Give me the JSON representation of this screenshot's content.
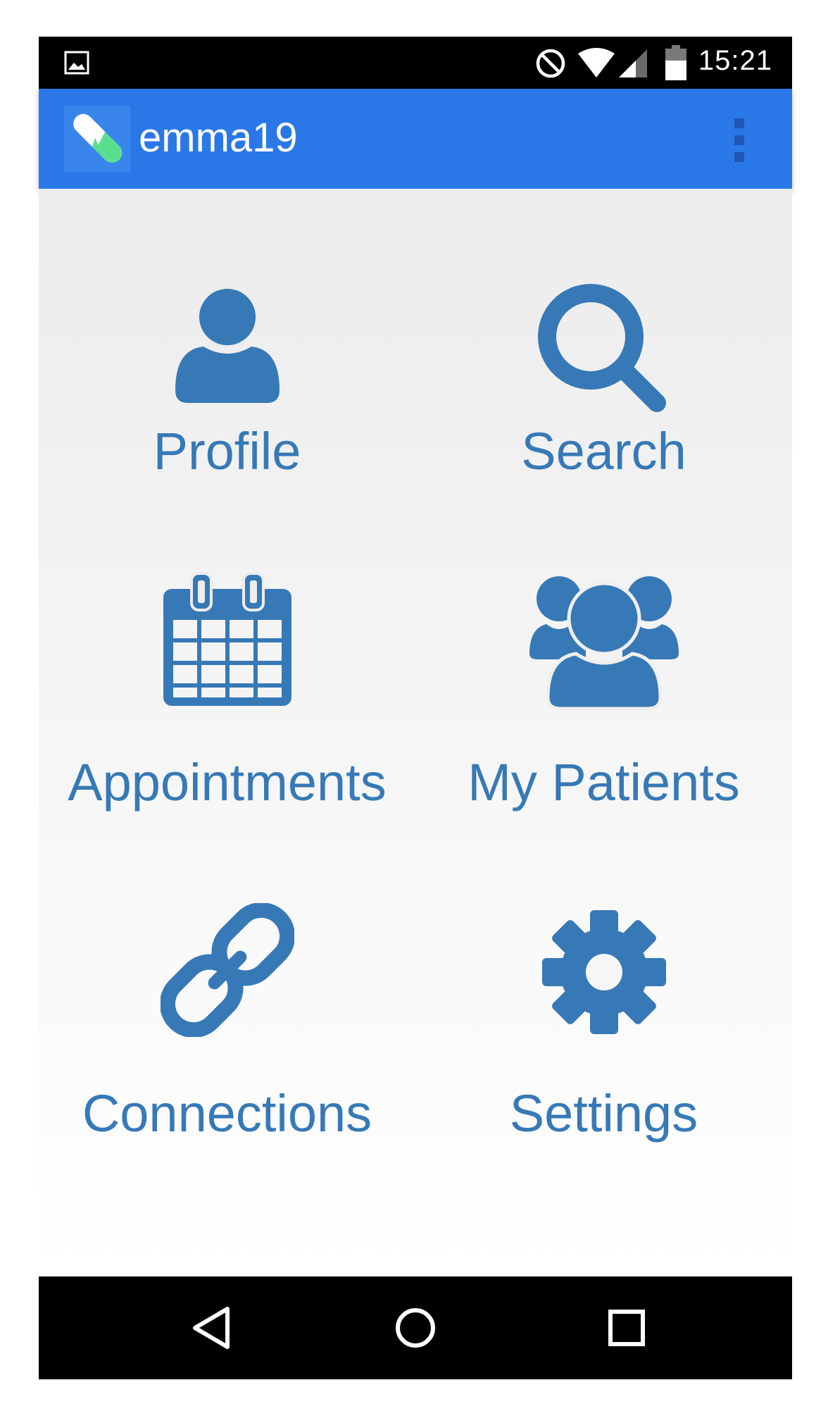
{
  "status_bar": {
    "time": "15:21",
    "icons": [
      "image-notification-icon",
      "do-not-disturb-icon",
      "wifi-icon",
      "cell-signal-icon",
      "battery-icon"
    ]
  },
  "app_bar": {
    "title": "emma19",
    "logo_icon": "pill-logo-icon",
    "menu_icon": "overflow-menu-icon",
    "color": "#2a78e8"
  },
  "grid": {
    "accent_color": "#3779b6",
    "tiles": [
      {
        "label": "Profile",
        "icon": "person-icon"
      },
      {
        "label": "Search",
        "icon": "magnifier-icon"
      },
      {
        "label": "Appointments",
        "icon": "calendar-icon"
      },
      {
        "label": "My Patients",
        "icon": "group-icon"
      },
      {
        "label": "Connections",
        "icon": "link-icon"
      },
      {
        "label": "Settings",
        "icon": "gear-icon"
      }
    ]
  },
  "nav_bar": {
    "icons": [
      "back-icon",
      "home-icon",
      "recents-icon"
    ]
  }
}
